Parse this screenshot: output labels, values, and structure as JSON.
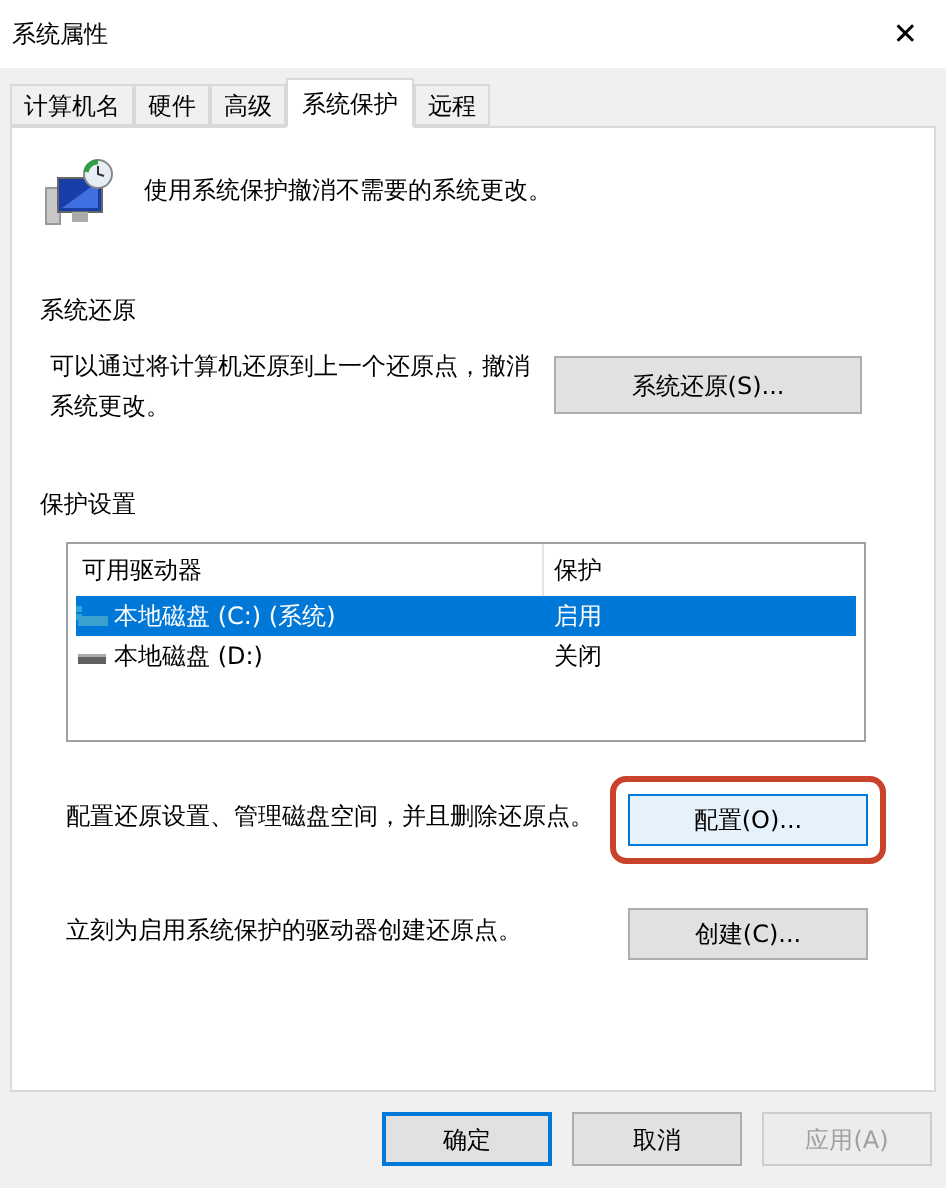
{
  "window": {
    "title": "系统属性",
    "close": "✕"
  },
  "tabs": [
    {
      "label": "计算机名",
      "selected": false
    },
    {
      "label": "硬件",
      "selected": false
    },
    {
      "label": "高级",
      "selected": false
    },
    {
      "label": "系统保护",
      "selected": true
    },
    {
      "label": "远程",
      "selected": false
    }
  ],
  "intro": "使用系统保护撤消不需要的系统更改。",
  "restore": {
    "heading": "系统还原",
    "text": "可以通过将计算机还原到上一个还原点，撤消系统更改。",
    "button": "系统还原(S)..."
  },
  "protection": {
    "heading": "保护设置",
    "columns": [
      "可用驱动器",
      "保护"
    ],
    "drives": [
      {
        "name": "本地磁盘 (C:) (系统)",
        "protection": "启用",
        "selected": true,
        "kind": "system"
      },
      {
        "name": "本地磁盘 (D:)",
        "protection": "关闭",
        "selected": false,
        "kind": "local"
      }
    ],
    "configure": {
      "text": "配置还原设置、管理磁盘空间，并且删除还原点。",
      "button": "配置(O)...",
      "highlighted": true
    },
    "create": {
      "text": "立刻为启用系统保护的驱动器创建还原点。",
      "button": "创建(C)..."
    }
  },
  "buttons": [
    {
      "label": "确定",
      "default": true,
      "disabled": false
    },
    {
      "label": "取消",
      "default": false,
      "disabled": false
    },
    {
      "label": "应用(A)",
      "default": false,
      "disabled": true
    }
  ]
}
